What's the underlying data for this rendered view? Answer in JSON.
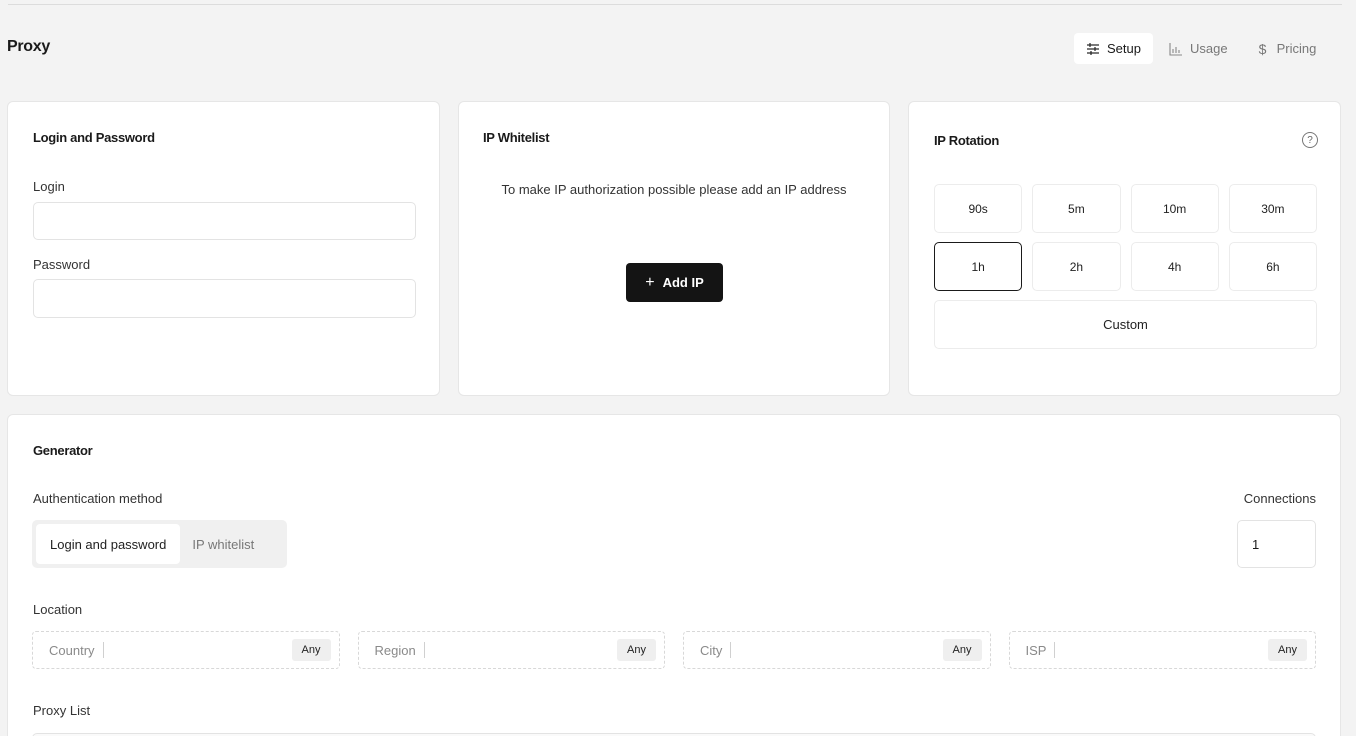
{
  "header": {
    "title": "Proxy"
  },
  "tabs": [
    {
      "label": "Setup",
      "icon": "sliders-icon",
      "active": true
    },
    {
      "label": "Usage",
      "icon": "chart-icon",
      "active": false
    },
    {
      "label": "Pricing",
      "icon": "dollar-icon",
      "active": false
    }
  ],
  "login_card": {
    "title": "Login and Password",
    "login_label": "Login",
    "login_value": "",
    "password_label": "Password",
    "password_value": ""
  },
  "whitelist_card": {
    "title": "IP Whitelist",
    "message": "To make IP authorization possible please add an IP address",
    "add_button": "Add IP"
  },
  "rotation_card": {
    "title": "IP Rotation",
    "options": [
      "90s",
      "5m",
      "10m",
      "30m",
      "1h",
      "2h",
      "4h",
      "6h"
    ],
    "selected": "1h",
    "custom_label": "Custom"
  },
  "generator": {
    "title": "Generator",
    "auth_label": "Authentication method",
    "auth_options": [
      "Login and password",
      "IP whitelist"
    ],
    "auth_selected": "Login and password",
    "connections_label": "Connections",
    "connections_value": "1",
    "location_label": "Location",
    "location_fields": [
      {
        "label": "Country",
        "value": "Any"
      },
      {
        "label": "Region",
        "value": "Any"
      },
      {
        "label": "City",
        "value": "Any"
      },
      {
        "label": "ISP",
        "value": "Any"
      }
    ],
    "proxy_list_label": "Proxy List"
  }
}
